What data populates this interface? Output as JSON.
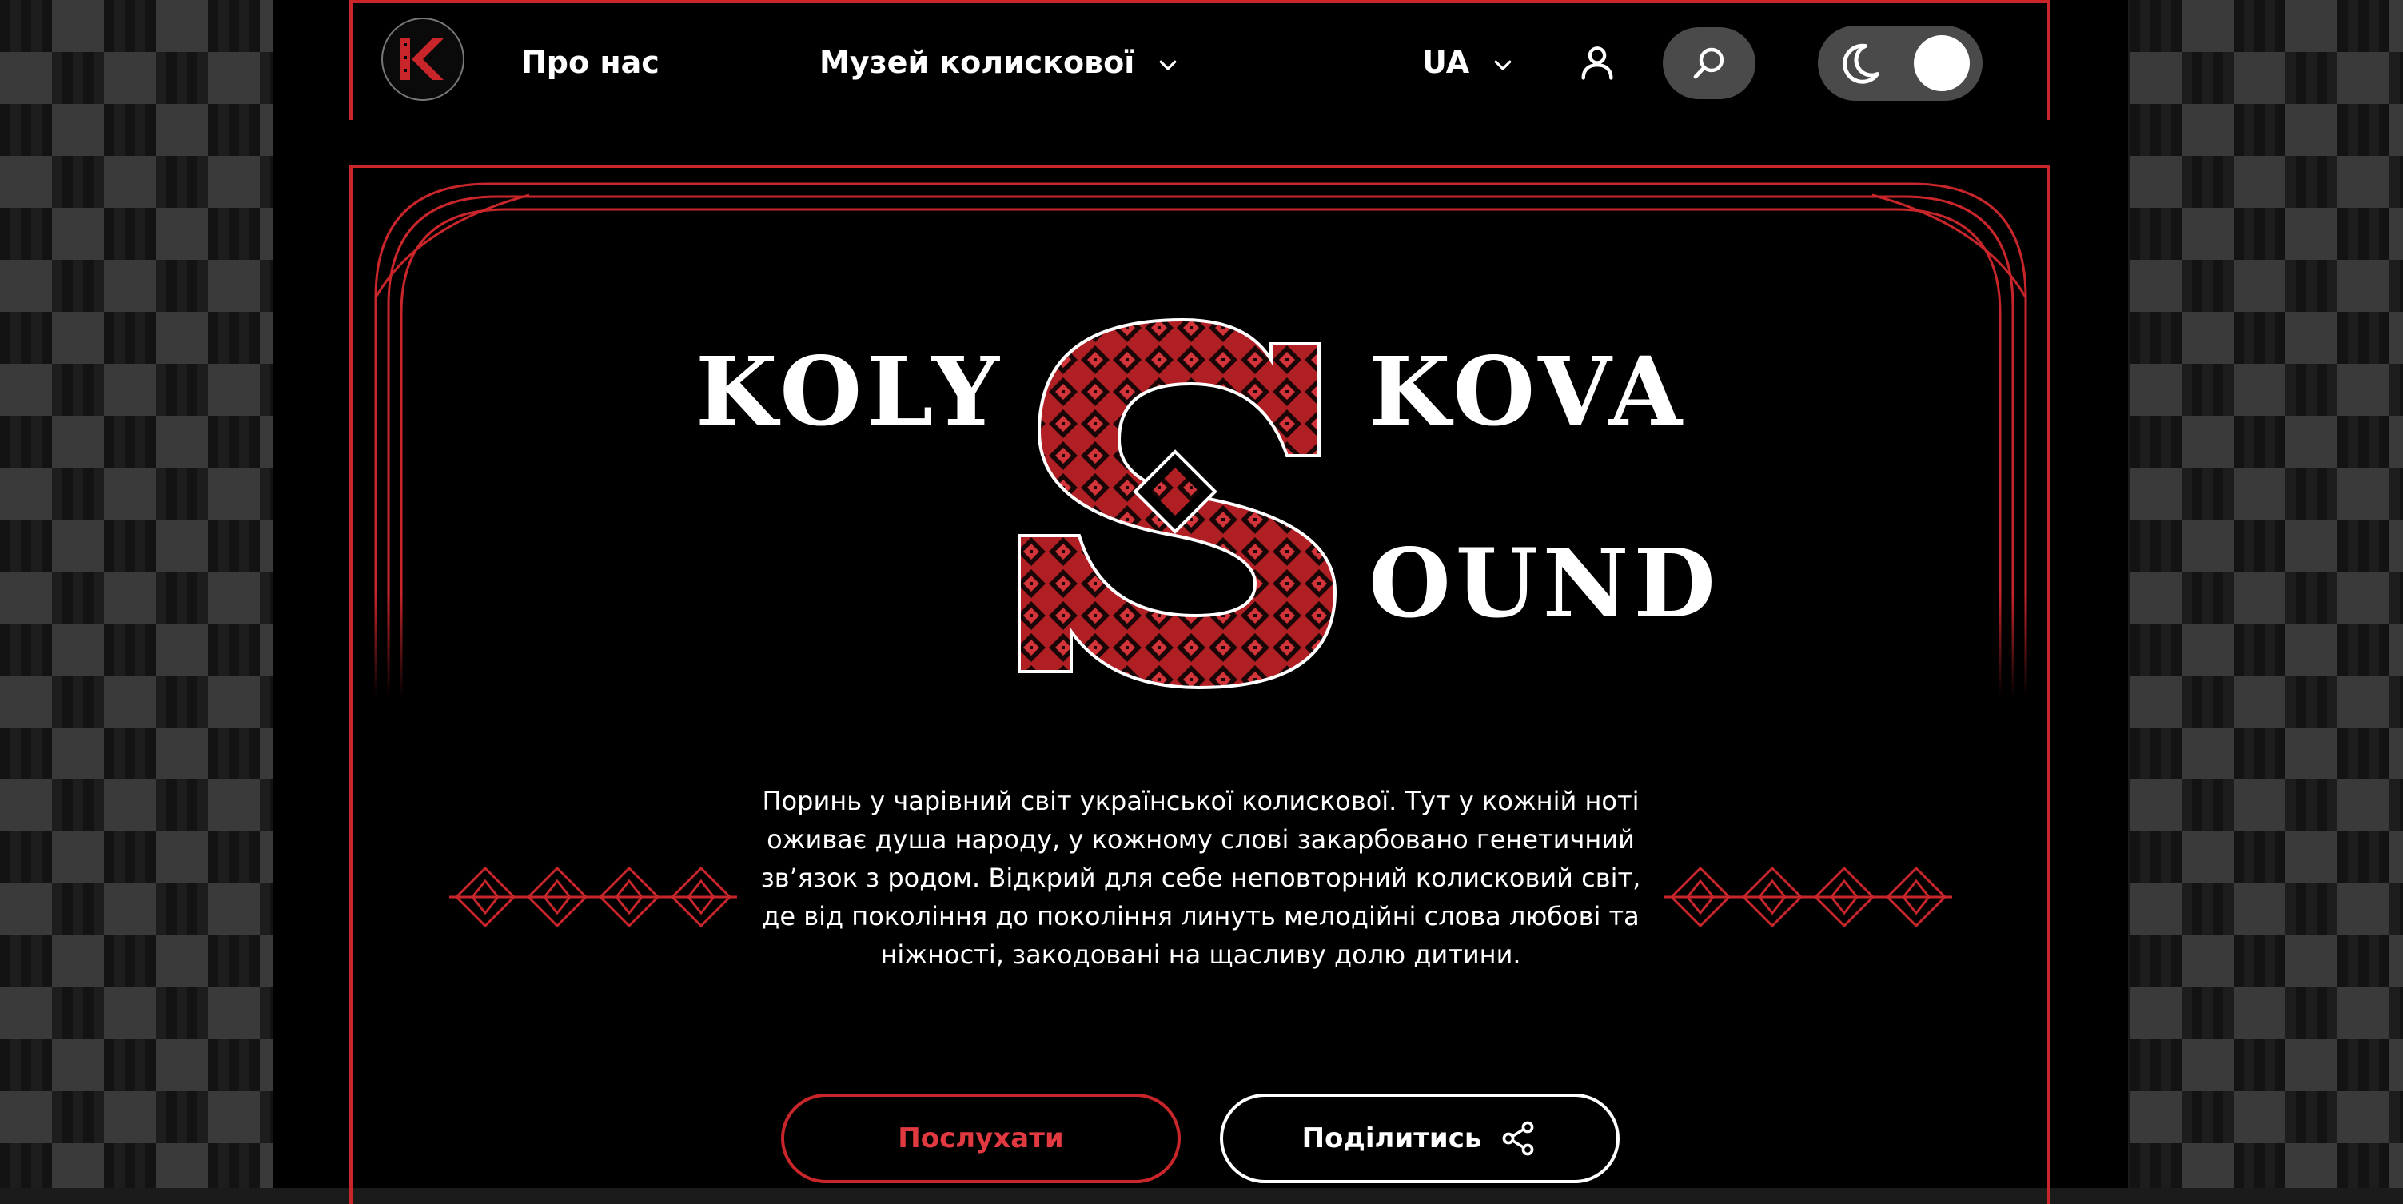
{
  "colors": {
    "accent": "#c8262b",
    "background": "#000000",
    "text": "#ffffff",
    "pill": "#4a4a4a"
  },
  "header": {
    "logo_icon": "kolyskova-logo-icon",
    "nav": {
      "about": "Про нас",
      "museum": "Музей колискової",
      "language": "UA"
    },
    "icons": [
      "chevron-down-icon",
      "user-icon",
      "search-icon",
      "moon-icon"
    ]
  },
  "hero": {
    "title_line1_left": "KOLY",
    "title_line1_right": "KOVA",
    "title_big_letter": "S",
    "title_line2": "OUND",
    "tagline": "Поринь у чарівний світ української колискової. Тут у кожній ноті оживає душа народу, у кожному слові закарбовано генетичний зв’язок з родом. Відкрий для себе неповторний колисковий світ, де від покоління до покоління линуть мелодійні слова любові та ніжності, закодовані на щасливу долю дитини.",
    "buttons": {
      "listen": "Послухати",
      "share": "Поділитись"
    }
  }
}
